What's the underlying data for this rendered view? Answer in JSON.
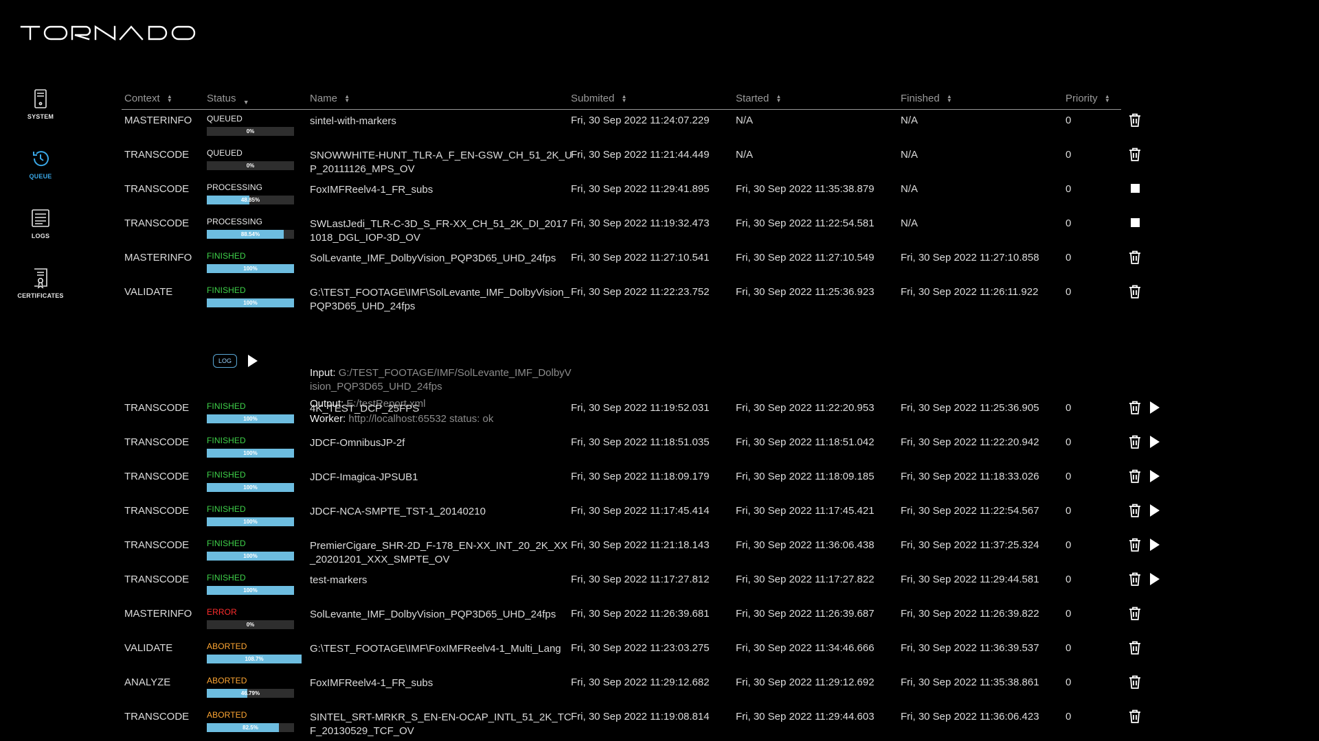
{
  "app": {
    "logo_text": "TORNADO"
  },
  "nav": [
    {
      "id": "system",
      "label": "SYSTEM",
      "icon": "server-icon",
      "active": false
    },
    {
      "id": "queue",
      "label": "QUEUE",
      "icon": "clock-refresh-icon",
      "active": true
    },
    {
      "id": "logs",
      "label": "LOGS",
      "icon": "document-lines-icon",
      "active": false
    },
    {
      "id": "certificates",
      "label": "CERTIFICATES",
      "icon": "certificate-icon",
      "active": false
    }
  ],
  "columns": {
    "context": "Context",
    "status": "Status",
    "name": "Name",
    "submitted": "Submited",
    "started": "Started",
    "finished": "Finished",
    "priority": "Priority"
  },
  "detail_labels": {
    "input": "Input:",
    "output": "Output:",
    "worker": "Worker:"
  },
  "log_button": "LOG",
  "colors": {
    "accent": "#3aa7e6",
    "progress": "#6dbde0",
    "finished": "#3fd34a",
    "error": "#ff2d2d",
    "aborted": "#ffa733"
  },
  "rows": [
    {
      "context": "MASTERINFO",
      "status": "QUEUED",
      "progress": 0,
      "progress_label": "0%",
      "name": "sintel-with-markers",
      "submitted": "Fri, 30 Sep 2022 11:24:07.229",
      "started": "N/A",
      "finished": "N/A",
      "priority": "0",
      "actions": [
        "delete"
      ]
    },
    {
      "context": "TRANSCODE",
      "status": "QUEUED",
      "progress": 0,
      "progress_label": "0%",
      "name": "SNOWWHITE-HUNT_TLR-A_F_EN-GSW_CH_51_2K_UP_20111126_MPS_OV",
      "submitted": "Fri, 30 Sep 2022 11:21:44.449",
      "started": "N/A",
      "finished": "N/A",
      "priority": "0",
      "actions": [
        "delete"
      ]
    },
    {
      "context": "TRANSCODE",
      "status": "PROCESSING",
      "progress": 48.85,
      "progress_label": "48.85%",
      "name": "FoxIMFReelv4-1_FR_subs",
      "submitted": "Fri, 30 Sep 2022 11:29:41.895",
      "started": "Fri, 30 Sep 2022 11:35:38.879",
      "finished": "N/A",
      "priority": "0",
      "actions": [
        "stop"
      ]
    },
    {
      "context": "TRANSCODE",
      "status": "PROCESSING",
      "progress": 88.54,
      "progress_label": "88.54%",
      "name": "SWLastJedi_TLR-C-3D_S_FR-XX_CH_51_2K_DI_20171018_DGL_IOP-3D_OV",
      "submitted": "Fri, 30 Sep 2022 11:19:32.473",
      "started": "Fri, 30 Sep 2022 11:22:54.581",
      "finished": "N/A",
      "priority": "0",
      "actions": [
        "stop"
      ]
    },
    {
      "context": "MASTERINFO",
      "status": "FINISHED",
      "progress": 100,
      "progress_label": "100%",
      "name": "SolLevante_IMF_DolbyVision_PQP3D65_UHD_24fps",
      "submitted": "Fri, 30 Sep 2022 11:27:10.541",
      "started": "Fri, 30 Sep 2022 11:27:10.549",
      "finished": "Fri, 30 Sep 2022 11:27:10.858",
      "priority": "0",
      "actions": [
        "delete"
      ]
    },
    {
      "context": "VALIDATE",
      "status": "FINISHED",
      "progress": 100,
      "progress_label": "100%",
      "name": "G:\\TEST_FOOTAGE\\IMF\\SolLevante_IMF_DolbyVision_PQP3D65_UHD_24fps",
      "submitted": "Fri, 30 Sep 2022 11:22:23.752",
      "started": "Fri, 30 Sep 2022 11:25:36.923",
      "finished": "Fri, 30 Sep 2022 11:26:11.922",
      "priority": "0",
      "actions": [
        "delete"
      ],
      "detail": {
        "input": "G:/TEST_FOOTAGE/IMF/SolLevante_IMF_DolbyVision_PQP3D65_UHD_24fps",
        "output": "E:/testReport.xml",
        "worker": "http://localhost:65532 status: ok"
      }
    },
    {
      "context": "TRANSCODE",
      "status": "FINISHED",
      "progress": 100,
      "progress_label": "100%",
      "name": "4K_TEST_DCP_25FPS",
      "submitted": "Fri, 30 Sep 2022 11:19:52.031",
      "started": "Fri, 30 Sep 2022 11:22:20.953",
      "finished": "Fri, 30 Sep 2022 11:25:36.905",
      "priority": "0",
      "actions": [
        "delete",
        "play"
      ]
    },
    {
      "context": "TRANSCODE",
      "status": "FINISHED",
      "progress": 100,
      "progress_label": "100%",
      "name": "JDCF-OmnibusJP-2f",
      "submitted": "Fri, 30 Sep 2022 11:18:51.035",
      "started": "Fri, 30 Sep 2022 11:18:51.042",
      "finished": "Fri, 30 Sep 2022 11:22:20.942",
      "priority": "0",
      "actions": [
        "delete",
        "play"
      ]
    },
    {
      "context": "TRANSCODE",
      "status": "FINISHED",
      "progress": 100,
      "progress_label": "100%",
      "name": "JDCF-Imagica-JPSUB1",
      "submitted": "Fri, 30 Sep 2022 11:18:09.179",
      "started": "Fri, 30 Sep 2022 11:18:09.185",
      "finished": "Fri, 30 Sep 2022 11:18:33.026",
      "priority": "0",
      "actions": [
        "delete",
        "play"
      ]
    },
    {
      "context": "TRANSCODE",
      "status": "FINISHED",
      "progress": 100,
      "progress_label": "100%",
      "name": "JDCF-NCA-SMPTE_TST-1_20140210",
      "submitted": "Fri, 30 Sep 2022 11:17:45.414",
      "started": "Fri, 30 Sep 2022 11:17:45.421",
      "finished": "Fri, 30 Sep 2022 11:22:54.567",
      "priority": "0",
      "actions": [
        "delete",
        "play"
      ]
    },
    {
      "context": "TRANSCODE",
      "status": "FINISHED",
      "progress": 100,
      "progress_label": "100%",
      "name": "PremierCigare_SHR-2D_F-178_EN-XX_INT_20_2K_XX_20201201_XXX_SMPTE_OV",
      "submitted": "Fri, 30 Sep 2022 11:21:18.143",
      "started": "Fri, 30 Sep 2022 11:36:06.438",
      "finished": "Fri, 30 Sep 2022 11:37:25.324",
      "priority": "0",
      "actions": [
        "delete",
        "play"
      ]
    },
    {
      "context": "TRANSCODE",
      "status": "FINISHED",
      "progress": 100,
      "progress_label": "100%",
      "name": "test-markers",
      "submitted": "Fri, 30 Sep 2022 11:17:27.812",
      "started": "Fri, 30 Sep 2022 11:17:27.822",
      "finished": "Fri, 30 Sep 2022 11:29:44.581",
      "priority": "0",
      "actions": [
        "delete",
        "play"
      ]
    },
    {
      "context": "MASTERINFO",
      "status": "ERROR",
      "progress": 0,
      "progress_label": "0%",
      "name": "SolLevante_IMF_DolbyVision_PQP3D65_UHD_24fps",
      "submitted": "Fri, 30 Sep 2022 11:26:39.681",
      "started": "Fri, 30 Sep 2022 11:26:39.687",
      "finished": "Fri, 30 Sep 2022 11:26:39.822",
      "priority": "0",
      "actions": [
        "delete"
      ]
    },
    {
      "context": "VALIDATE",
      "status": "ABORTED",
      "progress": 108.7,
      "progress_label": "108.7%",
      "name": "G:\\TEST_FOOTAGE\\IMF\\FoxIMFReelv4-1_Multi_Lang",
      "submitted": "Fri, 30 Sep 2022 11:23:03.275",
      "started": "Fri, 30 Sep 2022 11:34:46.666",
      "finished": "Fri, 30 Sep 2022 11:36:39.537",
      "priority": "0",
      "actions": [
        "delete"
      ]
    },
    {
      "context": "ANALYZE",
      "status": "ABORTED",
      "progress": 46.79,
      "progress_label": "46.79%",
      "name": "FoxIMFReelv4-1_FR_subs",
      "submitted": "Fri, 30 Sep 2022 11:29:12.682",
      "started": "Fri, 30 Sep 2022 11:29:12.692",
      "finished": "Fri, 30 Sep 2022 11:35:38.861",
      "priority": "0",
      "actions": [
        "delete"
      ]
    },
    {
      "context": "TRANSCODE",
      "status": "ABORTED",
      "progress": 82.5,
      "progress_label": "82.5%",
      "name": "SINTEL_SRT-MRKR_S_EN-EN-OCAP_INTL_51_2K_TCF_20130529_TCF_OV",
      "submitted": "Fri, 30 Sep 2022 11:19:08.814",
      "started": "Fri, 30 Sep 2022 11:29:44.603",
      "finished": "Fri, 30 Sep 2022 11:36:06.423",
      "priority": "0",
      "actions": [
        "delete"
      ]
    }
  ]
}
